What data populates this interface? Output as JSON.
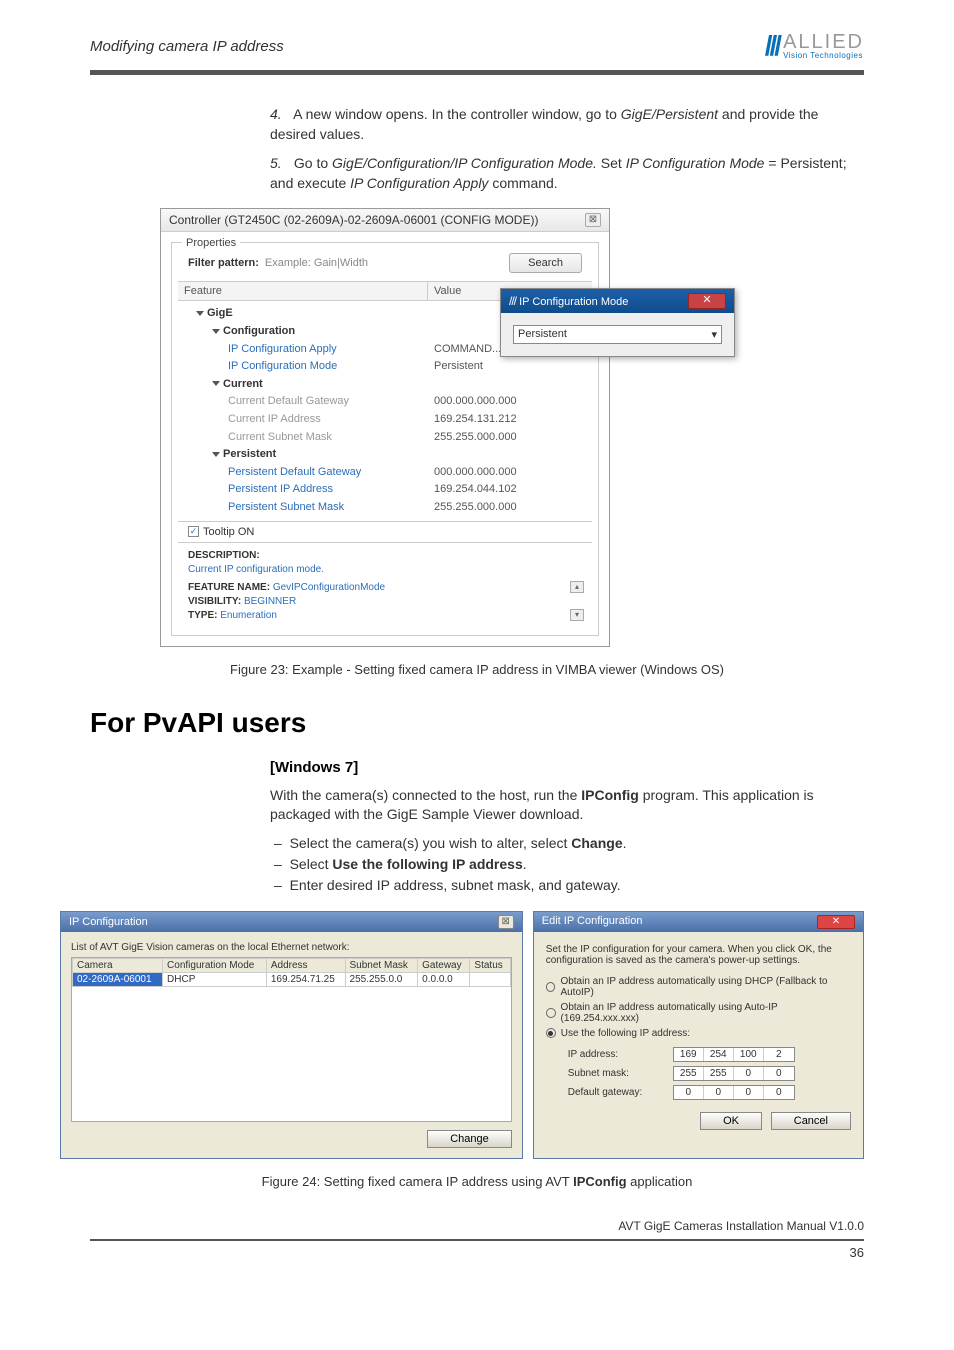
{
  "header": {
    "title": "Modifying camera IP address",
    "logo_main": "ALLIED",
    "logo_sub": "Vision Technologies"
  },
  "steps": {
    "s4": {
      "num": "4.",
      "text_a": "A new window opens. In the controller window, go to ",
      "gige_persistent": "GigE/Persistent",
      "text_b": " and provide the desired values."
    },
    "s5": {
      "num": "5.",
      "text_a": "Go to ",
      "path": "GigE/Configuration/IP Configuration Mode.",
      "text_b": " Set ",
      "mode_label": "IP Configuration Mode",
      "eq": " = Persistent; and execute ",
      "apply": "IP Configuration Apply",
      "text_c": " command."
    }
  },
  "controller": {
    "title": "Controller (GT2450C (02-2609A)-02-2609A-06001 (CONFIG MODE))",
    "props_label": "Properties",
    "filter_label": "Filter pattern:",
    "filter_hint": "Example: Gain|Width",
    "search": "Search",
    "col_feature": "Feature",
    "col_value": "Value",
    "tree": {
      "gige": "GigE",
      "config": "Configuration",
      "ip_apply": "IP Configuration Apply",
      "ip_apply_v": "COMMAND...",
      "ip_mode": "IP Configuration Mode",
      "ip_mode_v": "Persistent",
      "current": "Current",
      "cur_gw": "Current Default Gateway",
      "cur_gw_v": "000.000.000.000",
      "cur_ip": "Current IP Address",
      "cur_ip_v": "169.254.131.212",
      "cur_mask": "Current Subnet Mask",
      "cur_mask_v": "255.255.000.000",
      "persistent": "Persistent",
      "per_gw": "Persistent Default Gateway",
      "per_gw_v": "000.000.000.000",
      "per_ip": "Persistent IP Address",
      "per_ip_v": "169.254.044.102",
      "per_mask": "Persistent Subnet Mask",
      "per_mask_v": "255.255.000.000"
    },
    "tooltip": "Tooltip ON",
    "desc_h": "DESCRIPTION:",
    "desc_v": "Current IP configuration mode.",
    "feat_h": "FEATURE NAME:",
    "feat_v": "GevIPConfigurationMode",
    "vis_h": "VISIBILITY:",
    "vis_v": "BEGINNER",
    "type_h": "TYPE:",
    "type_v": "Enumeration",
    "popup_title": "IP Configuration Mode",
    "popup_value": "Persistent"
  },
  "fig23": "Figure 23: Example - Setting fixed camera IP address in VIMBA viewer (Windows OS)",
  "h2": "For PvAPI users",
  "win7": {
    "h3": "[Windows 7]",
    "p1a": "With the camera(s) connected to the host, run the ",
    "p1b": "IPConfig",
    "p1c": " program. This application is packaged with the GigE Sample Viewer download.",
    "b1a": "Select the camera(s) you wish to alter, select ",
    "b1b": "Change",
    "b1c": ".",
    "b2a": "Select ",
    "b2b": "Use the following IP address",
    "b2c": ".",
    "b3": "Enter desired IP address, subnet mask, and gateway."
  },
  "ipconfig": {
    "title": "IP Configuration",
    "list_label": "List of AVT GigE Vision cameras on the local Ethernet network:",
    "cols": {
      "camera": "Camera",
      "mode": "Configuration Mode",
      "addr": "Address",
      "mask": "Subnet Mask",
      "gw": "Gateway",
      "status": "Status"
    },
    "row": {
      "camera": "02-2609A-06001",
      "mode": "DHCP",
      "addr": "169.254.71.25",
      "mask": "255.255.0.0",
      "gw": "0.0.0.0",
      "status": ""
    },
    "change": "Change"
  },
  "edit": {
    "title": "Edit IP Configuration",
    "desc": "Set the IP configuration for your camera.  When you click OK, the configuration is saved as the camera's power-up settings.",
    "r1": "Obtain an IP address automatically using DHCP (Fallback to AutoIP)",
    "r2": "Obtain an IP address automatically using Auto-IP (169.254.xxx.xxx)",
    "r3": "Use the following IP address:",
    "ip_label": "IP address:",
    "ip": {
      "a": "169",
      "b": "254",
      "c": "100",
      "d": "2"
    },
    "mask_label": "Subnet mask:",
    "mask": {
      "a": "255",
      "b": "255",
      "c": "0",
      "d": "0"
    },
    "gw_label": "Default gateway:",
    "gw": {
      "a": "0",
      "b": "0",
      "c": "0",
      "d": "0"
    },
    "ok": "OK",
    "cancel": "Cancel"
  },
  "fig24_a": "Figure 24: Setting fixed camera IP address using AVT ",
  "fig24_b": "IPConfig",
  "fig24_c": " application",
  "footer": "AVT GigE Cameras Installation Manual V1.0.0",
  "page_num": "36"
}
